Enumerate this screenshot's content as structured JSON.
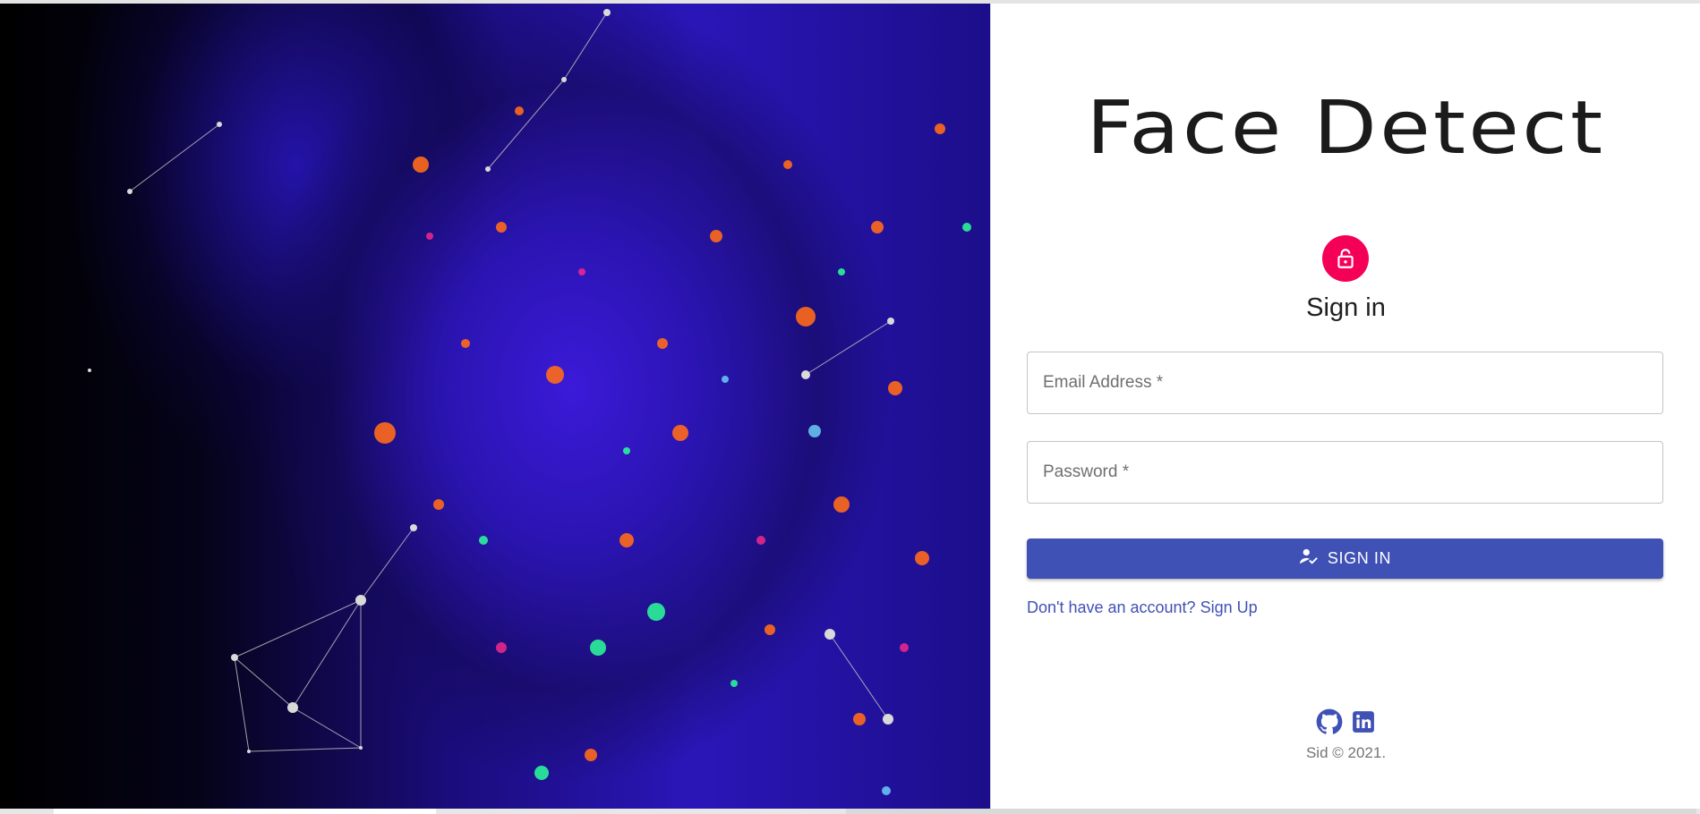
{
  "hero": {
    "image_description_icon": "glowing-face-image"
  },
  "brand": {
    "title": "Face Detect"
  },
  "signin": {
    "icon": "lock-icon",
    "title": "Sign in",
    "email_placeholder": "Email Address *",
    "password_placeholder": "Password *",
    "submit_label": "SIGN IN",
    "submit_icon": "person-check-icon",
    "signup_link": "Don't have an account? Sign Up"
  },
  "footer": {
    "icons": [
      "github-icon",
      "linkedin-icon"
    ],
    "copyright": "Sid © 2021."
  },
  "colors": {
    "accent": "#3f51b5",
    "avatar": "#f50057",
    "title": "#1b1b1b"
  }
}
